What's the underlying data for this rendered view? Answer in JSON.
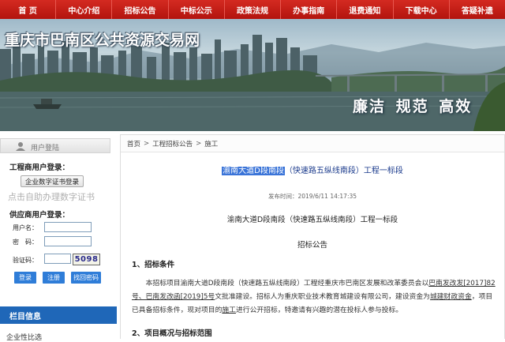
{
  "nav": [
    {
      "label": "首 页"
    },
    {
      "label": "中心介绍"
    },
    {
      "label": "招标公告"
    },
    {
      "label": "中标公示"
    },
    {
      "label": "政策法规"
    },
    {
      "label": "办事指南"
    },
    {
      "label": "退费通知"
    },
    {
      "label": "下载中心"
    },
    {
      "label": "答疑补遗"
    }
  ],
  "banner": {
    "site_title": "重庆市巴南区公共资源交易网",
    "slogan": "廉洁 规范 高效"
  },
  "login": {
    "header": "用户登陆",
    "engineer_label": "工程商用户登录：",
    "cert_button": "企业数字证书登录",
    "self_service": "点击自助办理数字证书",
    "supplier_label": "供应商用户登录：",
    "username_label": "用户名：",
    "password_label": "密　码：",
    "captcha_label": "验证码：",
    "captcha_code": "5098",
    "login_button": "登录",
    "register_button": "注册",
    "recover_button": "找回密码"
  },
  "column": {
    "header": "栏目信息",
    "first_item": "企业性比选"
  },
  "breadcrumb": {
    "home": "首页",
    "sep": ">",
    "section": "工程招标公告",
    "current": "施工"
  },
  "article": {
    "title_highlight": "渝南大道D段南段",
    "title_rest": "（快速路五纵线南段）工程一标段",
    "publish_time": "发布时间：2019/6/11 14:17:35",
    "subtitle": "渝南大道D段南段（快速路五纵线南段）工程一标段",
    "notice": "招标公告",
    "section1": "1、招标条件",
    "para1_a": "本招标项目渝南大道D段南段（快速路五纵线南段）工程经重庆市巴南区发展和改革委员会以",
    "para1_b": "巴南发改发[2017]82号、巴南发改函[2019]5号",
    "para1_c": "文批准建设。招标人为重庆职业技术教育城建设有限公司，建设资金为",
    "para1_d": "城建财政资金",
    "para1_e": "，项目已具备招标条件，现对项目的",
    "para1_f": "施工",
    "para1_g": "进行公开招标，特邀请有兴趣的潜在投标人参与投标。",
    "section2": "2、项目概况与招标范围"
  }
}
